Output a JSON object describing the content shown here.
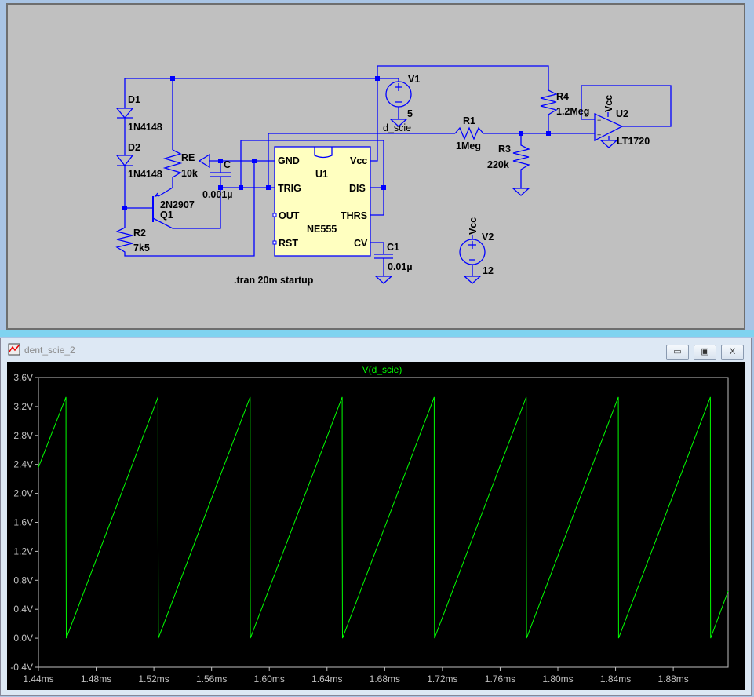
{
  "schematic": {
    "components": {
      "D1": {
        "name": "D1",
        "value": "1N4148"
      },
      "D2": {
        "name": "D2",
        "value": "1N4148"
      },
      "RE": {
        "name": "RE",
        "value": "10k"
      },
      "C": {
        "name": "C",
        "value": "0.001µ"
      },
      "Q1": {
        "name": "Q1",
        "value": "2N2907"
      },
      "R2": {
        "name": "R2",
        "value": "7k5"
      },
      "U1": {
        "name": "U1",
        "value": "NE555",
        "pins": [
          "GND",
          "Vcc",
          "TRIG",
          "DIS",
          "OUT",
          "THRS",
          "RST",
          "CV"
        ]
      },
      "C1": {
        "name": "C1",
        "value": "0.01µ"
      },
      "V1": {
        "name": "V1",
        "value": "5"
      },
      "R1": {
        "name": "R1",
        "value": "1Meg"
      },
      "R3": {
        "name": "R3",
        "value": "220k"
      },
      "R4": {
        "name": "R4",
        "value": "1.2Meg"
      },
      "U2": {
        "name": "U2",
        "value": "LT1720",
        "supply": "Vcc"
      },
      "V2": {
        "name": "V2",
        "value": "12",
        "net": "Vcc"
      }
    },
    "net_label": "d_scie",
    "directive": ".tran 20m startup",
    "colors": {
      "wire": "#0000ff",
      "background": "#c0c0c0",
      "ic_fill": "#ffffc0"
    }
  },
  "plot_window": {
    "title": "dent_scie_2",
    "buttons": [
      "minimize",
      "restore",
      "close"
    ],
    "button_glyphs": [
      "▭",
      "▣",
      "X"
    ]
  },
  "chart_data": {
    "type": "line",
    "title": "V(d_scie)",
    "xlabel": "",
    "ylabel": "",
    "xlim": [
      1.44,
      1.918
    ],
    "ylim": [
      -0.4,
      3.6
    ],
    "xticks": [
      "1.44ms",
      "1.48ms",
      "1.52ms",
      "1.56ms",
      "1.60ms",
      "1.64ms",
      "1.68ms",
      "1.72ms",
      "1.76ms",
      "1.80ms",
      "1.84ms",
      "1.88ms"
    ],
    "xtick_values": [
      1.44,
      1.48,
      1.52,
      1.56,
      1.6,
      1.64,
      1.68,
      1.72,
      1.76,
      1.8,
      1.84,
      1.88
    ],
    "yticks": [
      "3.6V",
      "3.2V",
      "2.8V",
      "2.4V",
      "2.0V",
      "1.6V",
      "1.2V",
      "0.8V",
      "0.4V",
      "0.0V",
      "-0.4V"
    ],
    "ytick_values": [
      3.6,
      3.2,
      2.8,
      2.4,
      2.0,
      1.6,
      1.2,
      0.8,
      0.4,
      0.0,
      -0.4
    ],
    "grid": false,
    "colors": {
      "trace": "#00ff00",
      "background": "#000000",
      "axis": "#c0c0c0"
    },
    "series": [
      {
        "name": "V(d_scie)",
        "x_unit": "ms",
        "y_unit": "V",
        "points": [
          [
            1.44,
            2.36
          ],
          [
            1.4591,
            3.33
          ],
          [
            1.4591,
            1.62
          ],
          [
            1.4593,
            0.0
          ],
          [
            1.5229,
            3.33
          ],
          [
            1.5229,
            1.62
          ],
          [
            1.5231,
            0.0
          ],
          [
            1.5867,
            3.33
          ],
          [
            1.5867,
            1.62
          ],
          [
            1.5869,
            0.0
          ],
          [
            1.6505,
            3.33
          ],
          [
            1.6505,
            1.62
          ],
          [
            1.6507,
            0.0
          ],
          [
            1.7143,
            3.33
          ],
          [
            1.7143,
            1.62
          ],
          [
            1.7145,
            0.0
          ],
          [
            1.7781,
            3.33
          ],
          [
            1.7781,
            1.62
          ],
          [
            1.7783,
            0.0
          ],
          [
            1.8419,
            3.33
          ],
          [
            1.8419,
            1.62
          ],
          [
            1.8421,
            0.0
          ],
          [
            1.9057,
            3.33
          ],
          [
            1.9057,
            1.62
          ],
          [
            1.9059,
            0.0
          ],
          [
            1.918,
            0.65
          ]
        ]
      }
    ]
  }
}
